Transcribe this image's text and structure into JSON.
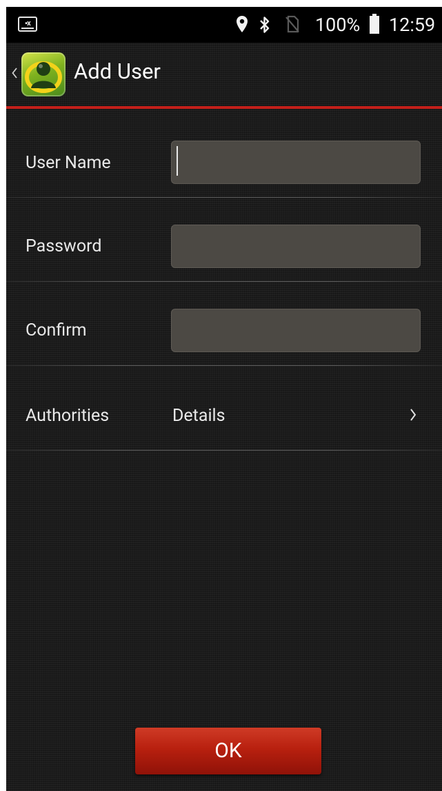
{
  "status_bar": {
    "notification_icon": "id-card-x-icon",
    "icons": [
      "location-pin-icon",
      "bluetooth-icon",
      "no-sim-icon"
    ],
    "battery_percent": "100%",
    "battery_icon": "battery-full-icon",
    "time": "12:59"
  },
  "action_bar": {
    "back_icon": "chevron-left-icon",
    "app_icon": "user-avatar-app-icon",
    "title": "Add User",
    "divider_color": "#c41f1a"
  },
  "form": {
    "user_name": {
      "label": "User Name",
      "value": "",
      "placeholder": ""
    },
    "password": {
      "label": "Password",
      "value": "",
      "placeholder": ""
    },
    "confirm": {
      "label": "Confirm",
      "value": "",
      "placeholder": ""
    },
    "authorities": {
      "label": "Authorities",
      "value": "Details",
      "icon": "chevron-right-icon"
    }
  },
  "ok_button": {
    "label": "OK",
    "color": "#b8200f"
  }
}
